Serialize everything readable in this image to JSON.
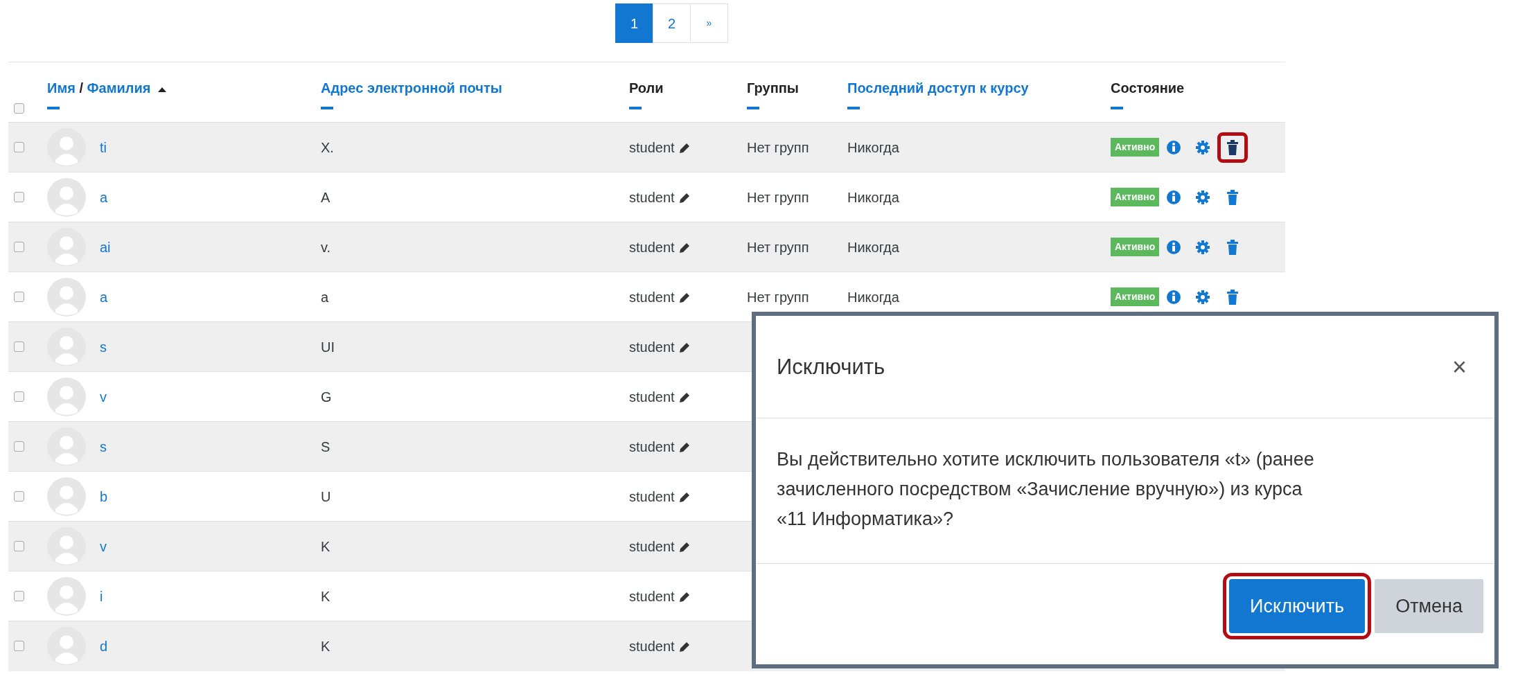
{
  "pagination": [
    {
      "label": "1",
      "selected": true
    },
    {
      "label": "2",
      "selected": false
    },
    {
      "label": "»",
      "selected": false
    }
  ],
  "table": {
    "select_all_checked": false,
    "columns": [
      {
        "parts": [
          {
            "text": "Имя",
            "kind": "link"
          },
          {
            "text": "/",
            "kind": "text"
          },
          {
            "text": "Фамилия",
            "kind": "link"
          }
        ],
        "sorted": true
      },
      {
        "parts": [
          {
            "text": "Адрес электронной почты",
            "kind": "link"
          }
        ],
        "sorted": false
      },
      {
        "parts": [
          {
            "text": "Роли",
            "kind": "text"
          }
        ],
        "sorted": false
      },
      {
        "parts": [
          {
            "text": "Группы",
            "kind": "text"
          }
        ],
        "sorted": false
      },
      {
        "parts": [
          {
            "text": "Последний доступ к курсу",
            "kind": "link"
          }
        ],
        "sorted": false
      },
      {
        "parts": [
          {
            "text": "Состояние",
            "kind": "text"
          }
        ],
        "sorted": false
      }
    ],
    "rows": [
      {
        "checked": false,
        "name": "ti",
        "email": "X.",
        "role": "student",
        "groups": "Нет групп",
        "last_access": "Никогда",
        "status": "Активно",
        "delete_highlighted": true
      },
      {
        "checked": false,
        "name": "a",
        "email": "A",
        "role": "student",
        "groups": "Нет групп",
        "last_access": "Никогда",
        "status": "Активно",
        "delete_highlighted": false
      },
      {
        "checked": false,
        "name": "ai",
        "email": "v.",
        "role": "student",
        "groups": "Нет групп",
        "last_access": "Никогда",
        "status": "Активно",
        "delete_highlighted": false
      },
      {
        "checked": false,
        "name": "a",
        "email": "a",
        "role": "student",
        "groups": "Нет групп",
        "last_access": "Никогда",
        "status": "Активно",
        "delete_highlighted": false
      },
      {
        "checked": false,
        "name": "s",
        "email": "UI",
        "role": "student"
      },
      {
        "checked": false,
        "name": "v",
        "email": "G",
        "role": "student"
      },
      {
        "checked": false,
        "name": "s",
        "email": "S",
        "role": "student"
      },
      {
        "checked": false,
        "name": "b",
        "email": "U",
        "role": "student"
      },
      {
        "checked": false,
        "name": "v",
        "email": "K",
        "role": "student"
      },
      {
        "checked": false,
        "name": "i",
        "email": "K",
        "role": "student"
      },
      {
        "checked": false,
        "name": "d",
        "email": "K",
        "role": "student"
      }
    ]
  },
  "dialog": {
    "title": "Исключить",
    "close": "×",
    "message": "Вы действительно хотите исключить пользователя «t» (ранее зачисленного посредством «Зачисление вручную») из курса «11 Информатика»?",
    "buttons": [
      {
        "label": "Исключить",
        "kind": "primary",
        "highlighted": true
      },
      {
        "label": "Отмена",
        "kind": "secondary",
        "highlighted": false
      }
    ]
  }
}
